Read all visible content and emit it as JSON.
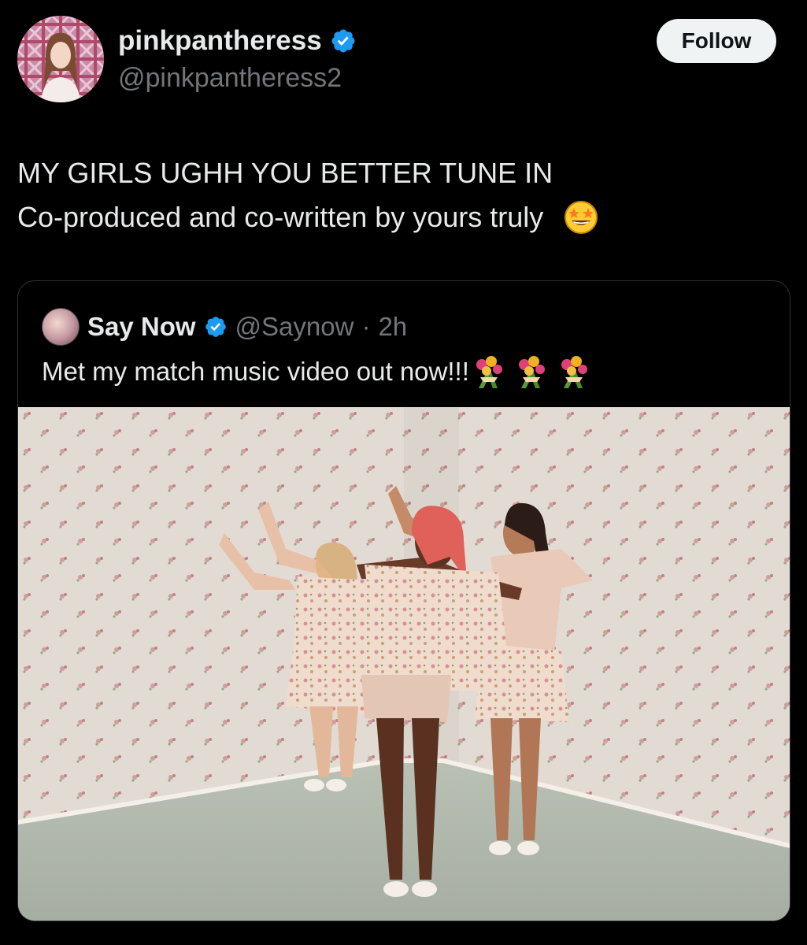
{
  "post": {
    "author": {
      "name": "pinkpantheress",
      "handle": "@pinkpantheress2",
      "verified": true
    },
    "follow_label": "Follow",
    "text_line1": "MY GIRLS UGHH YOU BETTER TUNE IN",
    "text_line2": "Co-produced and co-written by yours truly",
    "emoji": "star-struck-emoji"
  },
  "quoted": {
    "name": "Say Now",
    "handle": "@Saynow",
    "separator": "·",
    "time": "2h",
    "verified": true,
    "text": "Met my match music video out now!!!",
    "emoji_count": 3,
    "media": "music-video-still"
  },
  "colors": {
    "background": "#000000",
    "text": "#e7e9ea",
    "secondary": "#71767b",
    "verified": "#1d9bf0",
    "follow_bg": "#eff3f4"
  }
}
